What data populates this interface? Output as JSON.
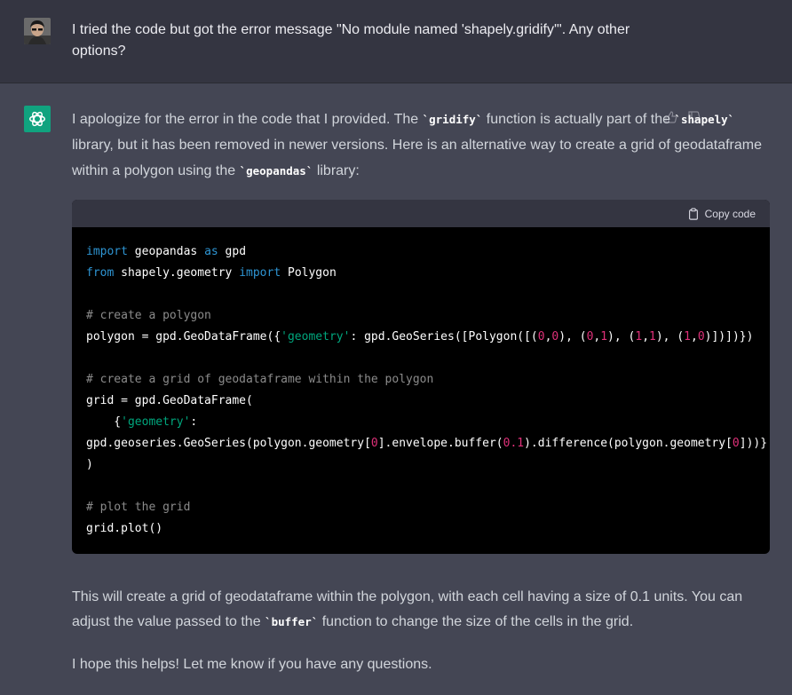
{
  "user_message": {
    "text": "I tried the code but got the error message \"No module named 'shapely.gridify'\". Any other options?"
  },
  "assistant_message": {
    "intro": {
      "t1": "I apologize for the error in the code that I provided. The ",
      "c1": "`gridify`",
      "t2": " function is actually part of the ",
      "c2": "`shapely`",
      "t3": " library, but it has been removed in newer versions. Here is an alternative way to create a grid of geodataframe within a polygon using the ",
      "c3": "`geopandas`",
      "t4": " library:"
    },
    "code_block": {
      "copy_label": "Copy code",
      "lines": {
        "l1": {
          "a": "import",
          "b": " geopandas ",
          "c": "as",
          "d": " gpd"
        },
        "l2": {
          "a": "from",
          "b": " shapely.geometry ",
          "c": "import",
          "d": " Polygon"
        },
        "l4": "# create a polygon",
        "l5": {
          "p1": "polygon = gpd.GeoDataFrame({",
          "s1": "'geometry'",
          "p2": ": gpd.GeoSeries([Polygon([(",
          "n1": "0",
          "p3": ",",
          "n2": "0",
          "p4": "), (",
          "n3": "0",
          "p5": ",",
          "n4": "1",
          "p6": "), (",
          "n5": "1",
          "p7": ",",
          "n6": "1",
          "p8": "), (",
          "n7": "1",
          "p9": ",",
          "n8": "0",
          "p10": ")])])})"
        },
        "l7": "# create a grid of geodataframe within the polygon",
        "l8": "grid = gpd.GeoDataFrame(",
        "l9": {
          "p1": "    {",
          "s1": "'geometry'",
          "p2": ":"
        },
        "l10": {
          "p1": "gpd.geoseries.GeoSeries(polygon.geometry[",
          "n1": "0",
          "p2": "].envelope.buffer(",
          "n2": "0.1",
          "p3": ").difference(polygon.geometry[",
          "n3": "0",
          "p4": "]))}"
        },
        "l11": ")",
        "l13": "# plot the grid",
        "l14": "grid.plot()"
      }
    },
    "outro": {
      "t1": "This will create a grid of geodataframe within the polygon, with each cell having a size of 0.1 units. You can adjust the value passed to the ",
      "c1": "`buffer`",
      "t2": " function to change the size of the cells in the grid."
    },
    "closing": "I hope this helps! Let me know if you have any questions."
  }
}
